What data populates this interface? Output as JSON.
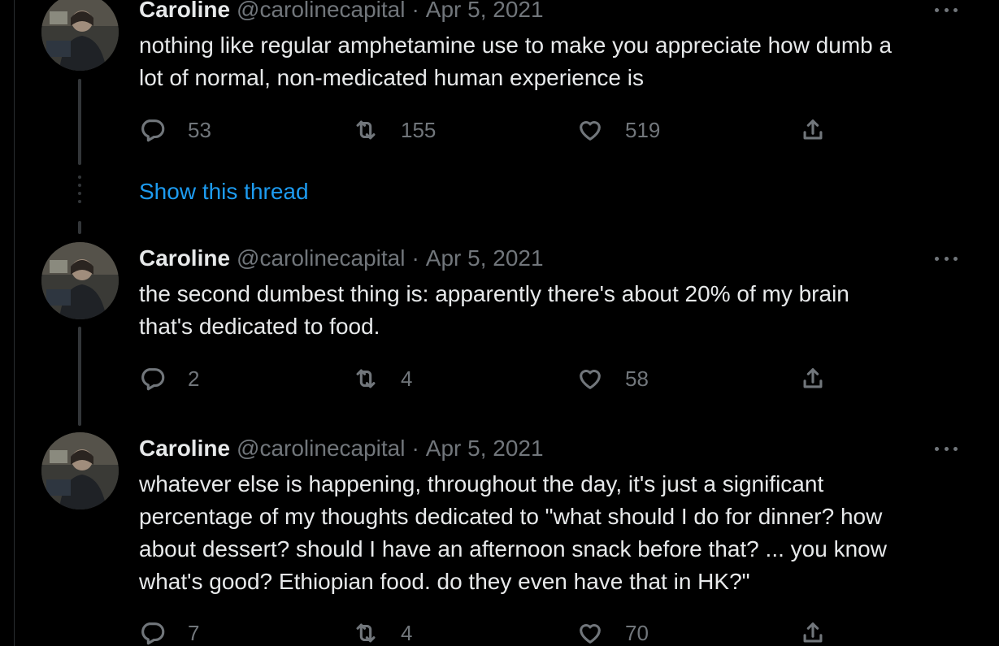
{
  "show_thread": "Show this thread",
  "tweets": [
    {
      "name": "Caroline",
      "handle": "@carolinecapital",
      "separator": "·",
      "date": "Apr 5, 2021",
      "lines": [
        "nothing like regular amphetamine use to make you appreciate how dumb a",
        "lot of normal, non-medicated human experience is"
      ],
      "replies": "53",
      "retweets": "155",
      "likes": "519"
    },
    {
      "name": "Caroline",
      "handle": "@carolinecapital",
      "separator": "·",
      "date": "Apr 5, 2021",
      "lines": [
        "the second dumbest thing is: apparently there's about 20% of my brain",
        "that's dedicated to food."
      ],
      "replies": "2",
      "retweets": "4",
      "likes": "58"
    },
    {
      "name": "Caroline",
      "handle": "@carolinecapital",
      "separator": "·",
      "date": "Apr 5, 2021",
      "lines": [
        "whatever else is happening, throughout the day, it's just a significant",
        "percentage of my thoughts dedicated to \"what should I do for dinner? how",
        "about dessert? should I have an afternoon snack before that? ... you know",
        "what's good? Ethiopian food. do they even have that in HK?\""
      ],
      "replies": "7",
      "retweets": "4",
      "likes": "70"
    }
  ],
  "colors": {
    "background": "#000000",
    "text": "#e7e9ea",
    "muted": "#71767b",
    "link": "#1d9bf0",
    "thread_line": "#333639"
  },
  "icons": [
    "reply-icon",
    "retweet-icon",
    "like-icon",
    "share-icon",
    "more-icon"
  ]
}
